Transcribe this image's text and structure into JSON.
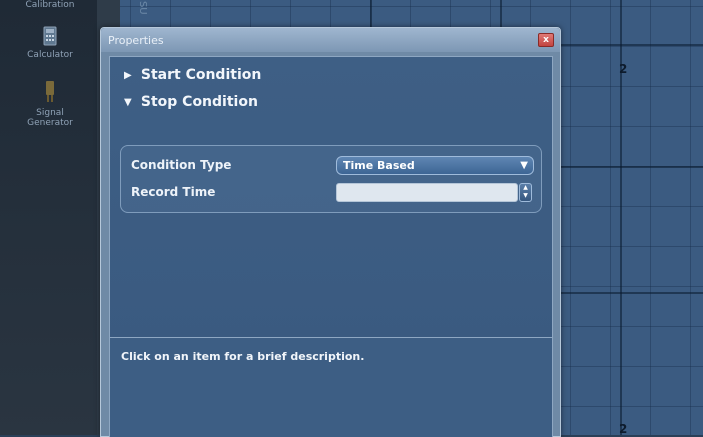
{
  "sidebar": {
    "tools": [
      {
        "label": "Calibration",
        "icon": "calibration-icon"
      },
      {
        "label": "Calculator",
        "icon": "calculator-icon"
      },
      {
        "label": "Signal Generator",
        "icon": "signal-generator-icon"
      }
    ],
    "signal_line1": "Signal",
    "signal_line2": "Generator"
  },
  "background": {
    "grid_label_top": "2",
    "grid_label_bottom": "2",
    "rotated_label": "ISU"
  },
  "dialog": {
    "title": "Properties",
    "close_glyph": "x",
    "sections": [
      {
        "label": "Start Condition",
        "expanded": false
      },
      {
        "label": "Stop Condition",
        "expanded": true
      }
    ],
    "expand_glyph_collapsed": "▶",
    "expand_glyph_expanded": "▼",
    "rows": {
      "condition_type_label": "Condition Type",
      "condition_type_value": "Time Based",
      "record_time_label": "Record Time",
      "record_time_value": ""
    },
    "description": "Click on an item for a brief description."
  },
  "colors": {
    "accent": "#3b5b81",
    "dialog_bg": "#6f8aa6",
    "panel_bg": "#3e5f85",
    "close_red": "#c24440"
  }
}
